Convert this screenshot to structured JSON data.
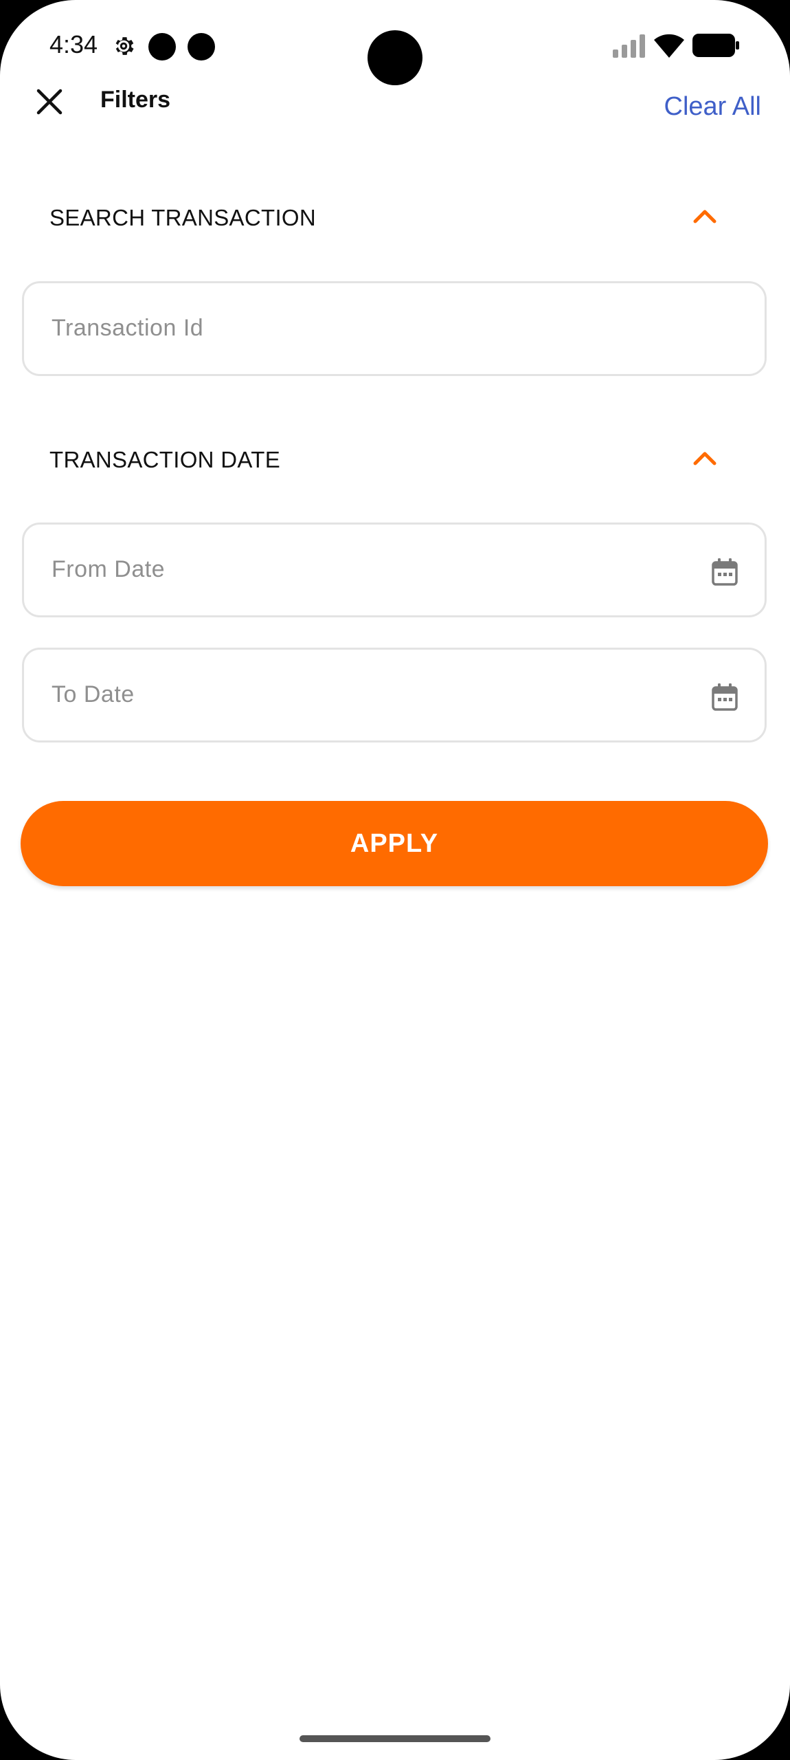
{
  "status_bar": {
    "time": "4:34",
    "icons": [
      "gear-icon",
      "notification-dot-icon",
      "notification-dot-icon",
      "signal-icon",
      "wifi-icon",
      "battery-icon"
    ]
  },
  "header": {
    "title": "Filters",
    "clear_all_label": "Clear All",
    "close_icon": "close-icon"
  },
  "sections": {
    "search": {
      "label": "SEARCH TRANSACTION",
      "transaction_id_placeholder": "Transaction Id"
    },
    "date": {
      "label": "TRANSACTION DATE",
      "from_placeholder": "From Date",
      "to_placeholder": "To Date"
    }
  },
  "apply_label": "APPLY",
  "colors": {
    "accent": "#ff6b00",
    "link": "#3f5fc8",
    "placeholder": "#8f8f8f",
    "border": "#e3e3e3"
  }
}
